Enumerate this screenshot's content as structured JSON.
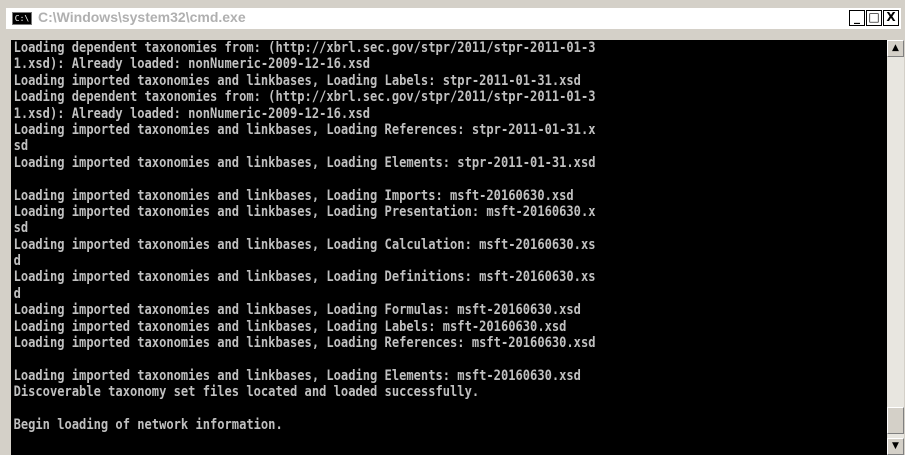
{
  "window": {
    "title": "C:\\Windows\\system32\\cmd.exe",
    "icon_text": "C:\\",
    "controls": {
      "minimize": "_",
      "maximize": "□",
      "close": "X"
    }
  },
  "console": {
    "lines": [
      "Loading dependent taxonomies from: (http://xbrl.sec.gov/stpr/2011/stpr-2011-01-3",
      "1.xsd): Already loaded: nonNumeric-2009-12-16.xsd",
      "Loading imported taxonomies and linkbases, Loading Labels: stpr-2011-01-31.xsd",
      "Loading dependent taxonomies from: (http://xbrl.sec.gov/stpr/2011/stpr-2011-01-3",
      "1.xsd): Already loaded: nonNumeric-2009-12-16.xsd",
      "Loading imported taxonomies and linkbases, Loading References: stpr-2011-01-31.x",
      "sd",
      "Loading imported taxonomies and linkbases, Loading Elements: stpr-2011-01-31.xsd",
      "",
      "Loading imported taxonomies and linkbases, Loading Imports: msft-20160630.xsd",
      "Loading imported taxonomies and linkbases, Loading Presentation: msft-20160630.x",
      "sd",
      "Loading imported taxonomies and linkbases, Loading Calculation: msft-20160630.xs",
      "d",
      "Loading imported taxonomies and linkbases, Loading Definitions: msft-20160630.xs",
      "d",
      "Loading imported taxonomies and linkbases, Loading Formulas: msft-20160630.xsd",
      "Loading imported taxonomies and linkbases, Loading Labels: msft-20160630.xsd",
      "Loading imported taxonomies and linkbases, Loading References: msft-20160630.xsd",
      "",
      "Loading imported taxonomies and linkbases, Loading Elements: msft-20160630.xsd",
      "Discoverable taxonomy set files located and loaded successfully.",
      "",
      "Begin loading of network information.",
      ""
    ]
  },
  "scrollbar": {
    "up_glyph": "▲",
    "down_glyph": "▼"
  }
}
